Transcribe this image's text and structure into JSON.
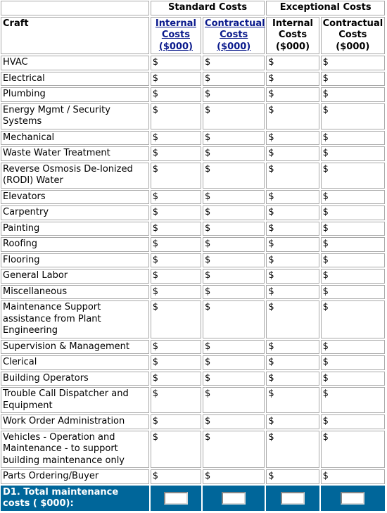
{
  "header": {
    "groups": [
      {
        "label": "Standard Costs"
      },
      {
        "label": "Exceptional Costs"
      }
    ],
    "craft_label": "Craft",
    "columns": [
      {
        "line1": "Internal",
        "line2": "Costs",
        "line3": "($000)",
        "is_link": true
      },
      {
        "line1": "Contractual",
        "line2": "Costs",
        "line3": "($000)",
        "is_link": true
      },
      {
        "line1": "Internal",
        "line2": "Costs",
        "line3": "($000)",
        "is_link": false
      },
      {
        "line1": "Contractual",
        "line2": "Costs ($000)",
        "line3": "",
        "is_link": false
      }
    ]
  },
  "currency_symbol": "$",
  "rows": [
    {
      "craft": "HVAC"
    },
    {
      "craft": "Electrical"
    },
    {
      "craft": "Plumbing"
    },
    {
      "craft": "Energy Mgmt / Security Systems"
    },
    {
      "craft": "Mechanical"
    },
    {
      "craft": "Waste Water Treatment"
    },
    {
      "craft": "Reverse Osmosis De-Ionized (RODI) Water"
    },
    {
      "craft": "Elevators"
    },
    {
      "craft": "Carpentry"
    },
    {
      "craft": "Painting"
    },
    {
      "craft": "Roofing"
    },
    {
      "craft": "Flooring"
    },
    {
      "craft": "General Labor"
    },
    {
      "craft": "Miscellaneous"
    },
    {
      "craft": "Maintenance Support assistance from Plant Engineering"
    },
    {
      "craft": "Supervision & Management"
    },
    {
      "craft": "Clerical"
    },
    {
      "craft": "Building Operators"
    },
    {
      "craft": "Trouble Call Dispatcher and Equipment"
    },
    {
      "craft": "Work Order Administration"
    },
    {
      "craft": "Vehicles - Operation and Maintenance - to support building maintenance only"
    },
    {
      "craft": "Parts Ordering/Buyer"
    }
  ],
  "total": {
    "label": "D1. Total maintenance costs ( $000):",
    "values": [
      "",
      "",
      "",
      ""
    ]
  },
  "colors": {
    "footer_bg": "#00669a",
    "link": "#0a1a8c",
    "border": "#a9a9a9"
  }
}
